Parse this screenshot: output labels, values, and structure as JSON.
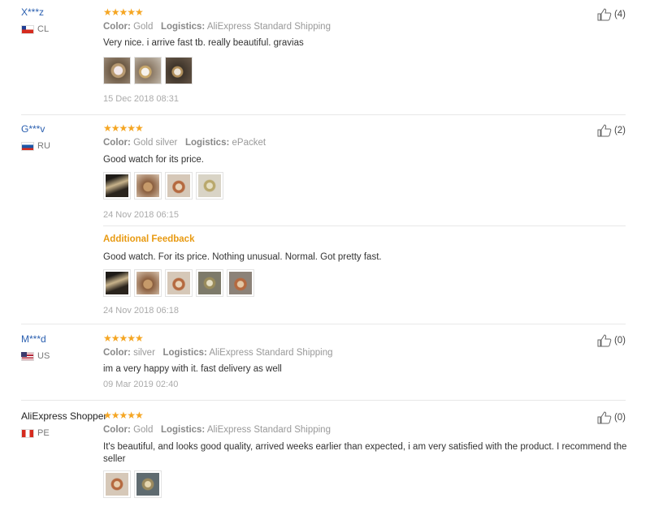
{
  "meta_labels": {
    "color": "Color:",
    "logistics": "Logistics:"
  },
  "reviews": [
    {
      "user": "X***z",
      "country": "CL",
      "stars": "★★★★★",
      "color": "Gold",
      "logistics": "AliExpress Standard Shipping",
      "text": "Very nice. i arrive fast tb. really beautiful. gravias",
      "date": "15 Dec 2018 08:31",
      "likes": "(4)"
    },
    {
      "user": "G***v",
      "country": "RU",
      "stars": "★★★★★",
      "color": "Gold silver",
      "logistics": "ePacket",
      "text": "Good watch for its price.",
      "date": "24 Nov 2018 06:15",
      "likes": "(2)",
      "additional": {
        "heading": "Additional Feedback",
        "text": "Good watch. For its price. Nothing unusual. Normal. Got pretty fast.",
        "date": "24 Nov 2018 06:18"
      }
    },
    {
      "user": "M***d",
      "country": "US",
      "stars": "★★★★★",
      "color": "silver",
      "logistics": "AliExpress Standard Shipping",
      "text": "im a very happy with it. fast delivery as well",
      "date": "09 Mar 2019 02:40",
      "likes": "(0)"
    },
    {
      "user": "AliExpress Shopper",
      "country": "PE",
      "stars": "★★★★★",
      "color": "Gold",
      "logistics": "AliExpress Standard Shipping",
      "text": "It's beautiful, and looks good quality, arrived weeks earlier than expected, i am very satisfied with the product. I recommend the seller",
      "likes": "(0)"
    }
  ],
  "icons": {
    "like": "thumbs-up-icon",
    "star": "star-icon"
  },
  "colors": {
    "link": "#2a5fb0",
    "star": "#f5a623",
    "additional": "#e89a12"
  }
}
